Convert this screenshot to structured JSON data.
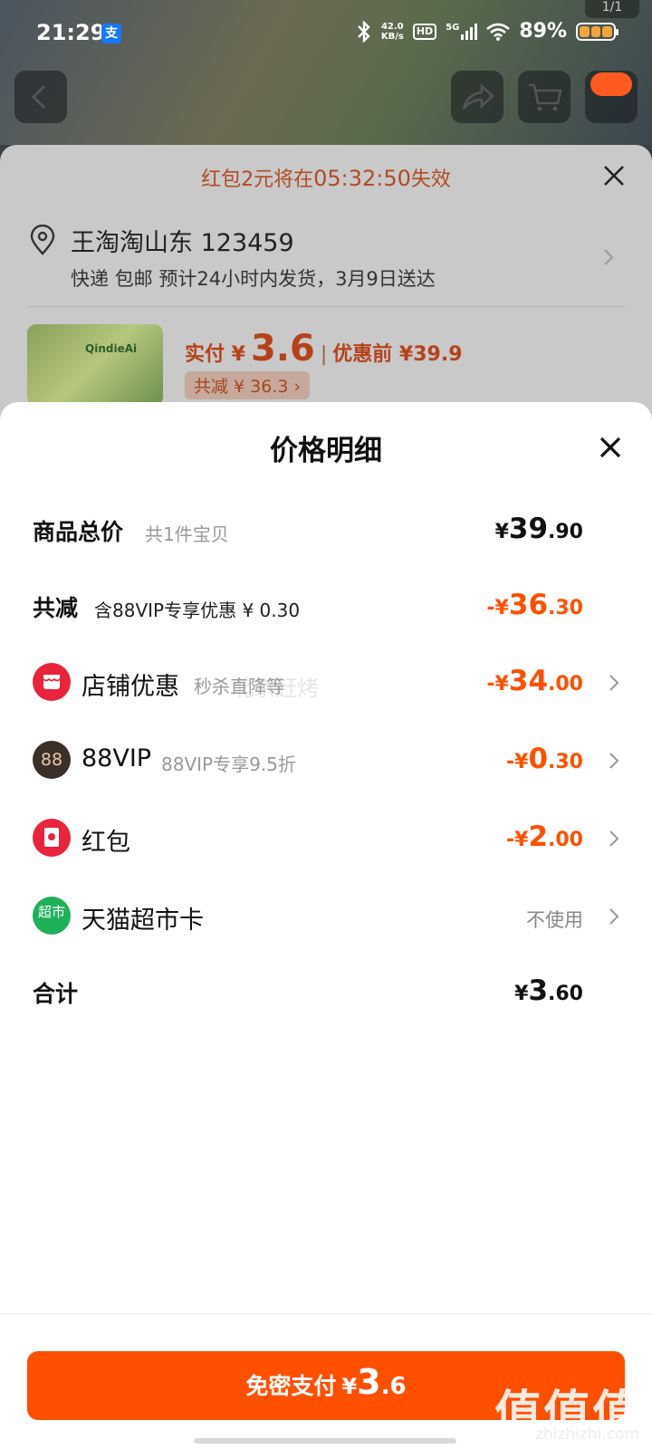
{
  "status_bar": {
    "time": "21:29",
    "alipay_badge": "支",
    "speed_value": "42.0",
    "speed_unit": "KB/s",
    "hd": "HD",
    "network": "5G",
    "battery": "89%"
  },
  "page_indicator": "1/1",
  "order": {
    "expire_prefix": "红包2元将在",
    "expire_timer": "05:32:50",
    "expire_suffix": "失效",
    "address": "王淘淘山东 123459",
    "shipping": "快递 包邮 预计24小时内发货，3月9日送达",
    "product_tag": "QindieAi",
    "pay_label": "实付 ¥",
    "pay_amount": "3.6",
    "sep": "|",
    "original_label": "优惠前 ¥39.9",
    "reduce_chip": "共减 ¥ 36.3 ›"
  },
  "detail": {
    "title": "价格明细",
    "rows": {
      "total": {
        "label": "商品总价",
        "sub": "共1件宝贝",
        "yen": "¥",
        "int": "39",
        "dec": ".90"
      },
      "reduce": {
        "label": "共减",
        "sub": "含88VIP专享优惠 ¥ 0.30",
        "yen": "-¥",
        "int": "36",
        "dec": ".30"
      },
      "shop": {
        "label": "店铺优惠",
        "sub": "秒杀直降等",
        "yen": "-¥",
        "int": "34",
        "dec": ".00"
      },
      "vip": {
        "icon_text": "88",
        "label": "88VIP",
        "sub": "88VIP专享9.5折",
        "yen": "-¥",
        "int": "0",
        "dec": ".30"
      },
      "redpacket": {
        "label": "红包",
        "yen": "-¥",
        "int": "2",
        "dec": ".00"
      },
      "tmallcard": {
        "icon_text": "超市",
        "label": "天猫超市卡",
        "value": "不使用"
      },
      "sum": {
        "label": "合计",
        "yen": "¥",
        "int": "3",
        "dec": ".60"
      }
    },
    "overlay_text": "北京赶烤"
  },
  "pay_button": {
    "label": "免密支付",
    "yen": "¥",
    "int": "3",
    "dec": ".6"
  },
  "watermark": {
    "text": "值值值",
    "url": "zhizhizhi.com"
  },
  "colors": {
    "accent": "#ff5000",
    "vip_icon": "#3b2f2a",
    "shop_icon": "#e8243c",
    "green_icon": "#1fb05a"
  }
}
